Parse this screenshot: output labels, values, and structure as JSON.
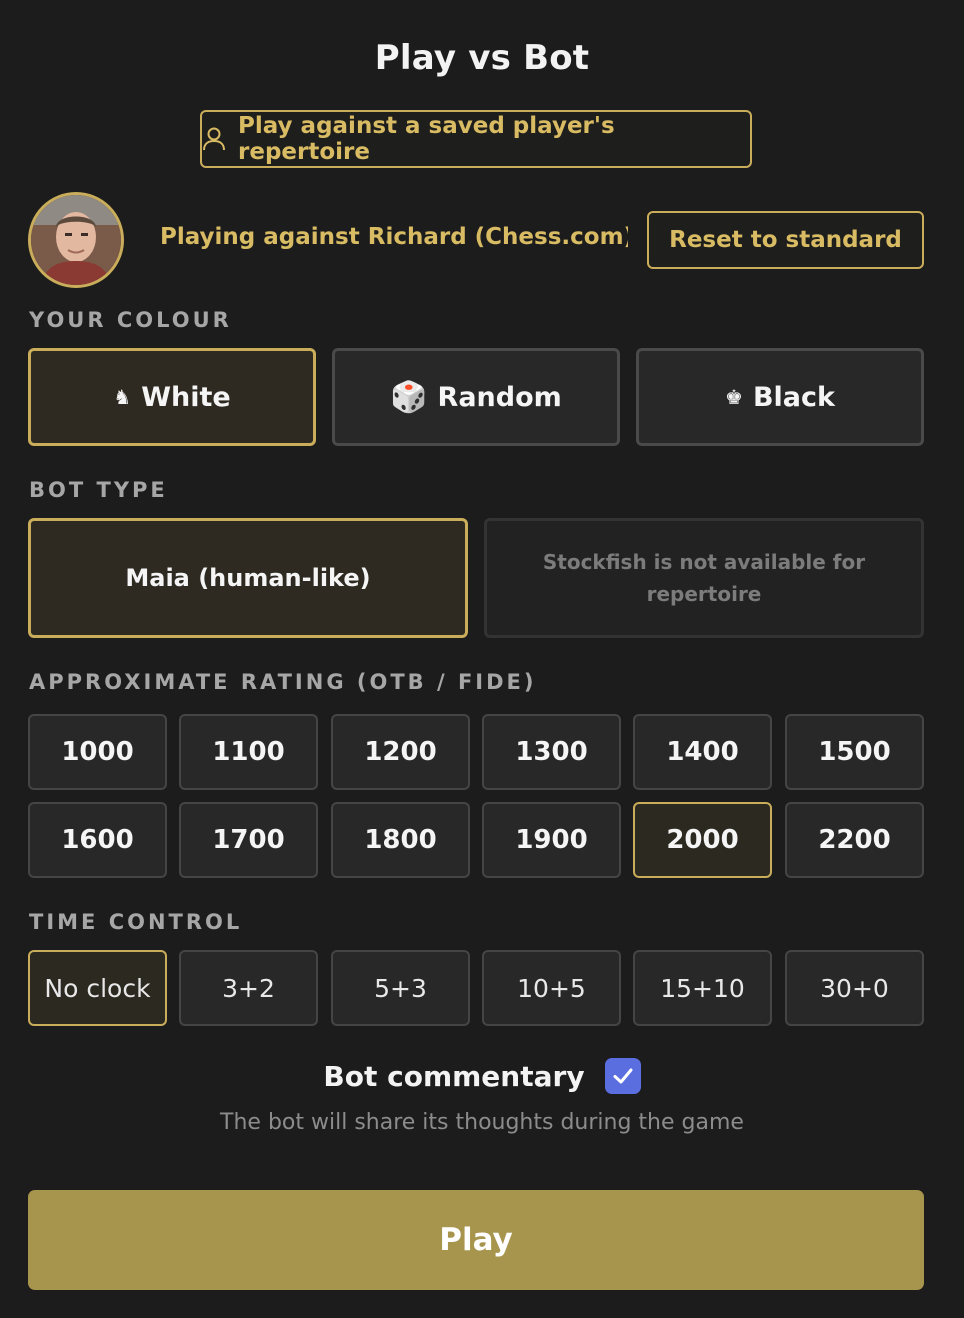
{
  "title": "Play vs Bot",
  "repertoire_button": {
    "label": "Play against a saved player's repertoire",
    "icon": "person-icon"
  },
  "opponent": {
    "avatar": "avatar-photo",
    "text": "Playing against Richard (Chess.com)'...",
    "reset_label": "Reset to standard"
  },
  "colour": {
    "heading": "YOUR COLOUR",
    "options": [
      {
        "label": "White",
        "icon": "♞",
        "selected": true
      },
      {
        "label": "Random",
        "icon": "🎲",
        "selected": false
      },
      {
        "label": "Black",
        "icon": "♚",
        "selected": false
      }
    ]
  },
  "bot_type": {
    "heading": "BOT TYPE",
    "maia_label": "Maia (human-like)",
    "stockfish_label": "Stockfish is not available for repertoire"
  },
  "rating": {
    "heading": "APPROXIMATE RATING (OTB / FIDE)",
    "options": [
      "1000",
      "1100",
      "1200",
      "1300",
      "1400",
      "1500",
      "1600",
      "1700",
      "1800",
      "1900",
      "2000",
      "2200"
    ],
    "selected": "2000"
  },
  "time_control": {
    "heading": "TIME CONTROL",
    "options": [
      "No clock",
      "3+2",
      "5+3",
      "10+5",
      "15+10",
      "30+0"
    ],
    "selected": "No clock"
  },
  "commentary": {
    "label": "Bot commentary",
    "checked": true,
    "hint": "The bot will share its thoughts during the game"
  },
  "play_label": "Play",
  "colors": {
    "accent": "#c9ad5a",
    "play": "#a8954d",
    "checkbox": "#5b6ee0"
  }
}
